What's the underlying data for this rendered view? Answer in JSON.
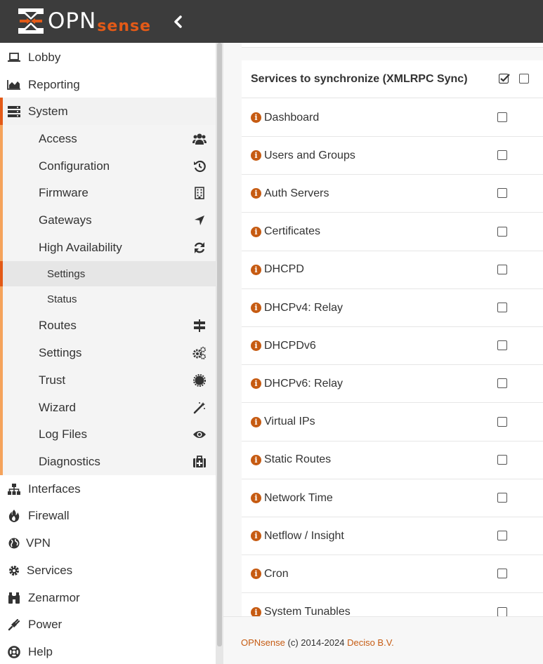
{
  "header": {
    "logo_main": "OPN",
    "logo_accent": "sense",
    "collapse_icon": "chevron-left-icon"
  },
  "sidebar": {
    "items": [
      {
        "label": "Lobby",
        "icon": "laptop-icon"
      },
      {
        "label": "Reporting",
        "icon": "area-chart-icon"
      },
      {
        "label": "System",
        "icon": "server-icon"
      },
      {
        "label": "Interfaces",
        "icon": "sitemap-icon"
      },
      {
        "label": "Firewall",
        "icon": "fire-icon"
      },
      {
        "label": "VPN",
        "icon": "globe-icon"
      },
      {
        "label": "Services",
        "icon": "cog-icon"
      },
      {
        "label": "Zenarmor",
        "icon": "binoculars-icon"
      },
      {
        "label": "Power",
        "icon": "plug-icon"
      },
      {
        "label": "Help",
        "icon": "life-ring-icon"
      }
    ],
    "system_children": [
      {
        "label": "Access",
        "icon": "users-icon"
      },
      {
        "label": "Configuration",
        "icon": "history-icon"
      },
      {
        "label": "Firmware",
        "icon": "building-icon"
      },
      {
        "label": "Gateways",
        "icon": "location-arrow-icon"
      },
      {
        "label": "High Availability",
        "icon": "refresh-icon"
      },
      {
        "label": "Routes",
        "icon": "map-signs-icon"
      },
      {
        "label": "Settings",
        "icon": "cogs-icon"
      },
      {
        "label": "Trust",
        "icon": "certificate-icon"
      },
      {
        "label": "Wizard",
        "icon": "magic-icon"
      },
      {
        "label": "Log Files",
        "icon": "eye-icon"
      },
      {
        "label": "Diagnostics",
        "icon": "medkit-icon"
      }
    ],
    "ha_children": [
      {
        "label": "Settings"
      },
      {
        "label": "Status"
      }
    ]
  },
  "table": {
    "header": "Services to synchronize (XMLRPC Sync)",
    "rows": [
      {
        "label": "Dashboard"
      },
      {
        "label": "Users and Groups"
      },
      {
        "label": "Auth Servers"
      },
      {
        "label": "Certificates"
      },
      {
        "label": "DHCPD"
      },
      {
        "label": "DHCPv4: Relay"
      },
      {
        "label": "DHCPDv6"
      },
      {
        "label": "DHCPv6: Relay"
      },
      {
        "label": "Virtual IPs"
      },
      {
        "label": "Static Routes"
      },
      {
        "label": "Network Time"
      },
      {
        "label": "Netflow / Insight"
      },
      {
        "label": "Cron"
      },
      {
        "label": "System Tunables"
      }
    ]
  },
  "footer": {
    "brand": "OPNsense",
    "copyright": "(c) 2014-2024",
    "company": "Deciso B.V."
  },
  "colors": {
    "accent": "#e35a17",
    "info": "#c65b12",
    "topbar": "#3c3c3c"
  }
}
